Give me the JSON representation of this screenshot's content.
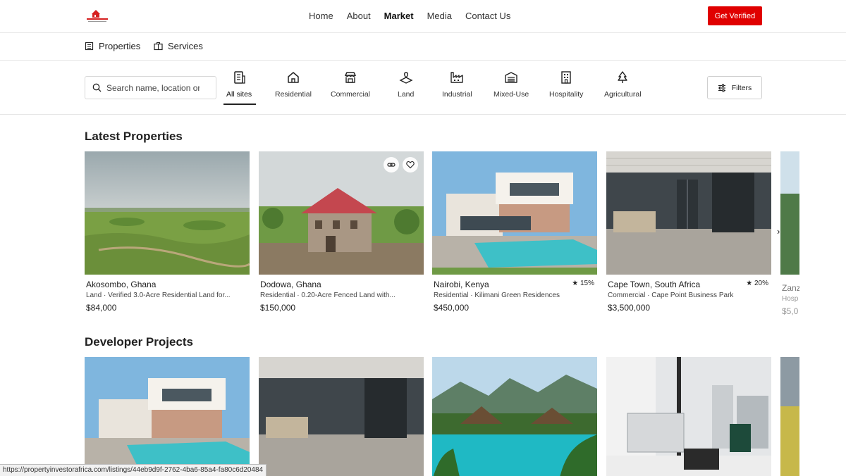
{
  "nav": {
    "links": [
      "Home",
      "About",
      "Market",
      "Media",
      "Contact Us"
    ],
    "active": "Market",
    "cta": "Get Verified"
  },
  "subtabs": [
    "Properties",
    "Services"
  ],
  "search": {
    "placeholder": "Search name, location or..."
  },
  "categories": [
    {
      "label": "All sites",
      "icon": "building-list-icon",
      "active": true
    },
    {
      "label": "Residential",
      "icon": "house-icon"
    },
    {
      "label": "Commercial",
      "icon": "store-icon"
    },
    {
      "label": "Land",
      "icon": "land-icon"
    },
    {
      "label": "Industrial",
      "icon": "factory-icon"
    },
    {
      "label": "Mixed-Use",
      "icon": "warehouse-icon"
    },
    {
      "label": "Hospitality",
      "icon": "hotel-icon"
    },
    {
      "label": "Agricultural",
      "icon": "tree-icon"
    }
  ],
  "filters_label": "Filters",
  "latest": {
    "title": "Latest Properties",
    "items": [
      {
        "location": "Akosombo, Ghana",
        "desc": "Land · Verified 3.0-Acre Residential Land for...",
        "price": "$84,000",
        "rating": ""
      },
      {
        "location": "Dodowa, Ghana",
        "desc": "Residential · 0.20-Acre Fenced Land with...",
        "price": "$150,000",
        "rating": ""
      },
      {
        "location": "Nairobi, Kenya",
        "desc": "Residential · Kilimani Green Residences",
        "price": "$450,000",
        "rating": "15%"
      },
      {
        "location": "Cape Town, South Africa",
        "desc": "Commercial · Cape Point Business Park",
        "price": "$3,500,000",
        "rating": "20%"
      }
    ],
    "partial": {
      "location": "Zanz",
      "desc": "Hosp",
      "price": "$5,0"
    }
  },
  "developer": {
    "title": "Developer Projects"
  },
  "status_url": "https://propertyinvestorafrica.com/listings/44eb9d9f-2762-4ba6-85a4-fa80c6d20484",
  "colors": {
    "accent": "#e00000"
  }
}
